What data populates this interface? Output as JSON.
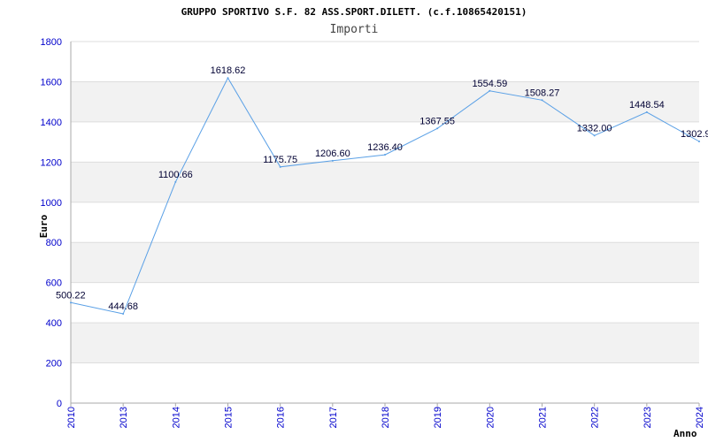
{
  "chart_data": {
    "type": "line",
    "title": "GRUPPO SPORTIVO S.F. 82 ASS.SPORT.DILETT. (c.f.10865420151)",
    "subtitle": "Importi",
    "xlabel": "Anno",
    "ylabel": "Euro",
    "ylim": [
      0,
      1800
    ],
    "yticks": [
      0,
      200,
      400,
      600,
      800,
      1000,
      1200,
      1400,
      1600,
      1800
    ],
    "categories": [
      "2010",
      "2013",
      "2014",
      "2015",
      "2016",
      "2017",
      "2018",
      "2019",
      "2020",
      "2021",
      "2022",
      "2023",
      "2024"
    ],
    "series": [
      {
        "values": [
          500.22,
          444.68,
          1100.66,
          1618.62,
          1175.75,
          1206.6,
          1236.4,
          1367.55,
          1554.59,
          1508.27,
          1332.0,
          1448.54,
          1302.9
        ],
        "labels": [
          "500.22",
          "444.68",
          "1100.66",
          "1618.62",
          "1175.75",
          "1206.60",
          "1236.40",
          "1367.55",
          "1554.59",
          "1508.27",
          "1332.00",
          "1448.54",
          "1302.9"
        ]
      }
    ],
    "grid": true,
    "colors": {
      "line": "#5aa0e6",
      "band": "#f2f2f2",
      "grid": "#dddddd",
      "axis": "#aaaaaa",
      "tick": "#0000cc"
    }
  }
}
